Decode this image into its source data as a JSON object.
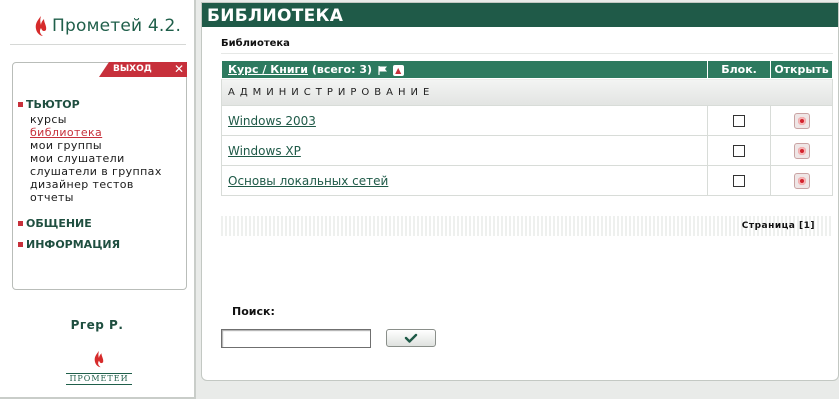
{
  "sidebar": {
    "logo_text": "Прометей 4.2.",
    "exit_label": "ВЫХОД",
    "sections": [
      {
        "label": "ТЬЮТОР"
      },
      {
        "label": "ОБЩЕНИЕ"
      },
      {
        "label": "ИНФОРМАЦИЯ"
      }
    ],
    "tutor_items": [
      "курсы",
      "библиотека",
      "мои группы",
      "мои слушатели",
      "слушатели в группах",
      "дизайнер тестов",
      "отчеты"
    ],
    "active_item": "библиотека",
    "user_name": "Ргер Р.",
    "bottom_logo_text": "ПРОМЕТЕЙ"
  },
  "main": {
    "title": "БИБЛИОТЕКА",
    "breadcrumb": "Библиотека",
    "table": {
      "col_course_link": "Курс / Книги",
      "col_course_count": " (всего: 3)",
      "col_block": "Блок.",
      "col_open": "Открыть",
      "group": "АДМИНИСТРИРОВАНИЕ",
      "rows": [
        {
          "name": "Windows 2003",
          "blocked": false
        },
        {
          "name": "Windows XP",
          "blocked": false
        },
        {
          "name": "Основы локальных сетей",
          "blocked": false
        }
      ]
    },
    "pager": "Страница [1]",
    "search": {
      "label": "Поиск:",
      "value": ""
    }
  },
  "colors": {
    "header_green": "#1f5a48",
    "table_head_green": "#2d7a5f",
    "accent_red": "#c7303b"
  },
  "icons": {
    "sort": "flag-sort-icon",
    "up": "arrow-up-icon",
    "open": "open-record-icon",
    "submit": "checkmark-icon",
    "close": "close-icon"
  }
}
